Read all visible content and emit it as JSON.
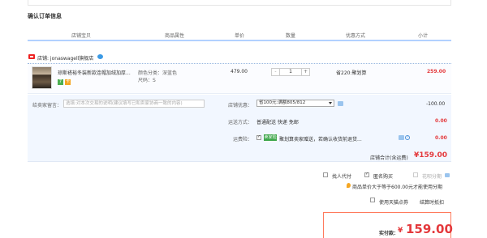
{
  "page_title": "确认订单信息",
  "columns": {
    "shop_item": "店铺宝贝",
    "attrs": "商品属性",
    "price": "单价",
    "qty": "数量",
    "discount": "优惠方式",
    "subtotal": "小计"
  },
  "shop": {
    "label": "店铺: jonaswagell旗舰店"
  },
  "item": {
    "title": "琼斯褡裕冬装新款连帽加绒加厚...",
    "color": "颜色分类：深蓝色",
    "size": "尺码：S",
    "badges": [
      "7",
      "卡"
    ],
    "price": "479.00",
    "qty": "1",
    "qty_minus": "-",
    "qty_plus": "+",
    "discount": "省220:聚划算",
    "subtotal": "259.00"
  },
  "message": {
    "label": "给卖家留言：",
    "placeholder": "选填:对本次交易的说明(建议填写已和卖家协商一致的内容)"
  },
  "coupon": {
    "label": "店铺优惠：",
    "selected": "省100元:满额805/812",
    "amount": "-100.00"
  },
  "shipping": {
    "label": "运送方式：",
    "value": "普通配送 快递 免邮",
    "amount": "0.00"
  },
  "insurance": {
    "label": "运费险：",
    "tag": "卖家险",
    "text": "聚划算卖家赠送，若确认收货前退货...",
    "amount": "0.00"
  },
  "shop_total": {
    "label": "店铺合计(含运费)",
    "value": "¥159.00"
  },
  "options": {
    "proxy_pay": "找人代付",
    "anonymous": "匿名购买",
    "installment": "花呗分期",
    "installment_note": "商品单价大于等于600.00元才能使用分期",
    "tmall_points": "使用天猫点券",
    "points_rules": "结算时抵扣"
  },
  "final": {
    "label": "实付款：",
    "value": "159.00",
    "currency": "¥"
  },
  "colors": {
    "accent_red": "#e4393c",
    "header_line": "#b2d1ff"
  }
}
